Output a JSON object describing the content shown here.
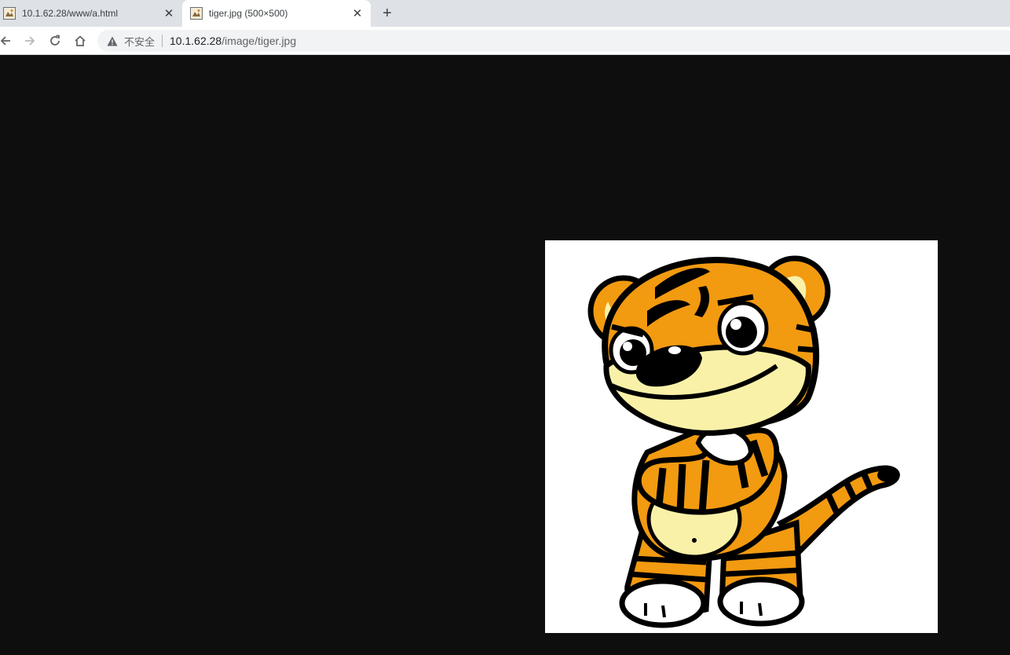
{
  "tabs": [
    {
      "title": "10.1.62.28/www/a.html",
      "close_icon": "close-icon"
    },
    {
      "title": "tiger.jpg (500×500)",
      "close_icon": "close-icon"
    }
  ],
  "new_tab": {
    "label": "+"
  },
  "toolbar": {
    "back_icon": "arrow-left-icon",
    "forward_icon": "arrow-right-icon",
    "reload_icon": "reload-icon",
    "home_icon": "home-icon"
  },
  "omnibox": {
    "security_label": "不安全",
    "url_host": "10.1.62.28",
    "url_path": "/image/tiger.jpg"
  },
  "image": {
    "description_icon": "tiger-cartoon-image",
    "background": "#0e0e0e"
  },
  "colors": {
    "tabstrip": "#dee1e6",
    "tiger_orange": "#f29a10",
    "tiger_cream": "#faf1a8"
  }
}
